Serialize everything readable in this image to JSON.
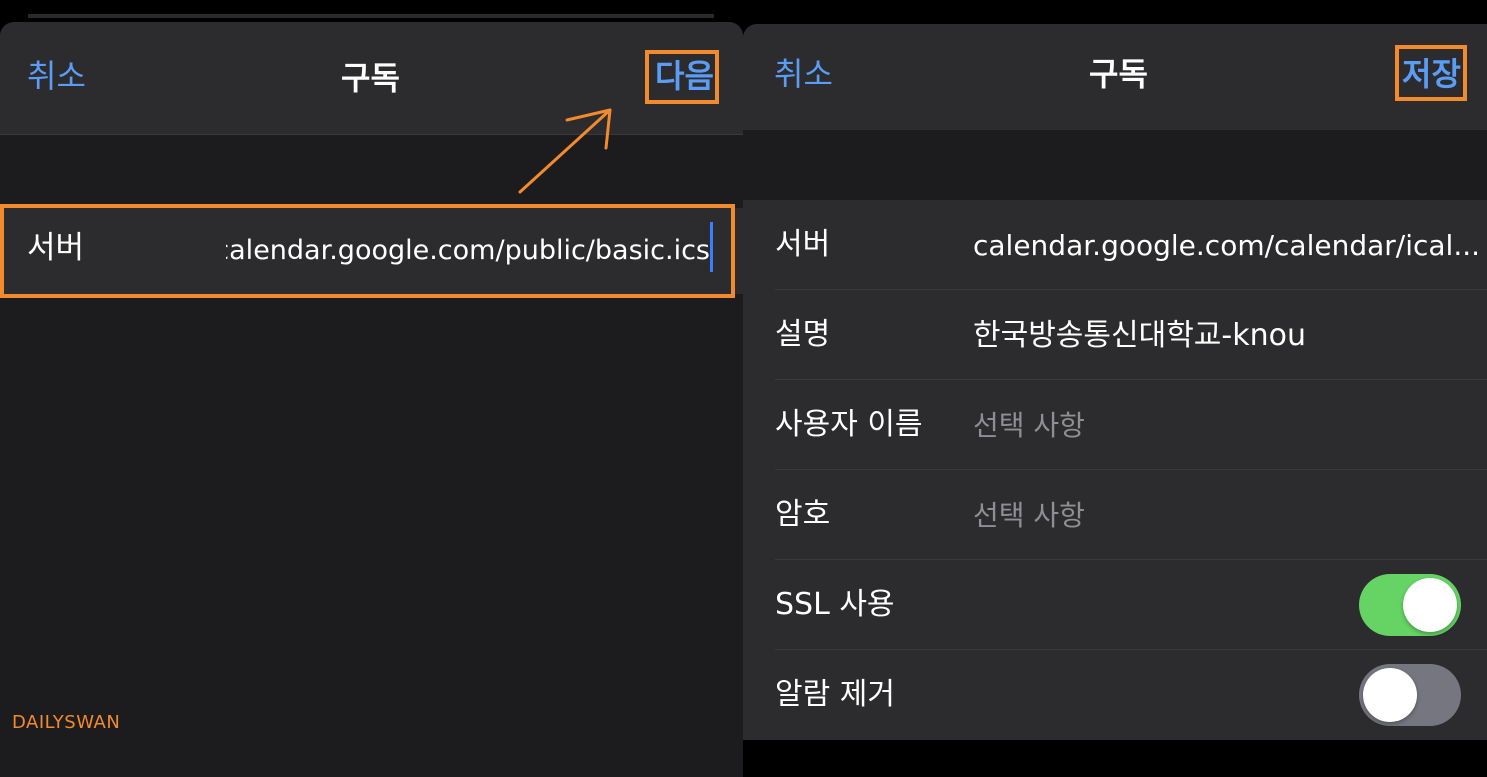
{
  "left": {
    "nav": {
      "cancel": "취소",
      "title": "구독",
      "next": "다음"
    },
    "server": {
      "label": "서버",
      "value": "calendar.google.com/public/basic.ics"
    }
  },
  "right": {
    "nav": {
      "cancel": "취소",
      "title": "구독",
      "save": "저장"
    },
    "rows": [
      {
        "label": "서버",
        "value": "calendar.google.com/calendar/ical..."
      },
      {
        "label": "설명",
        "value": "한국방송통신대학교-knou"
      },
      {
        "label": "사용자 이름",
        "placeholder": "선택 사항"
      },
      {
        "label": "암호",
        "placeholder": "선택 사항"
      },
      {
        "label": "SSL 사용",
        "toggle": true
      },
      {
        "label": "알람 제거",
        "toggle": false
      }
    ]
  },
  "watermark": "DAILYSWAN",
  "colors": {
    "accent": "#5b9cf4",
    "highlight": "#f28a2e",
    "toggle_on": "#65d465",
    "toggle_off": "#767680"
  }
}
